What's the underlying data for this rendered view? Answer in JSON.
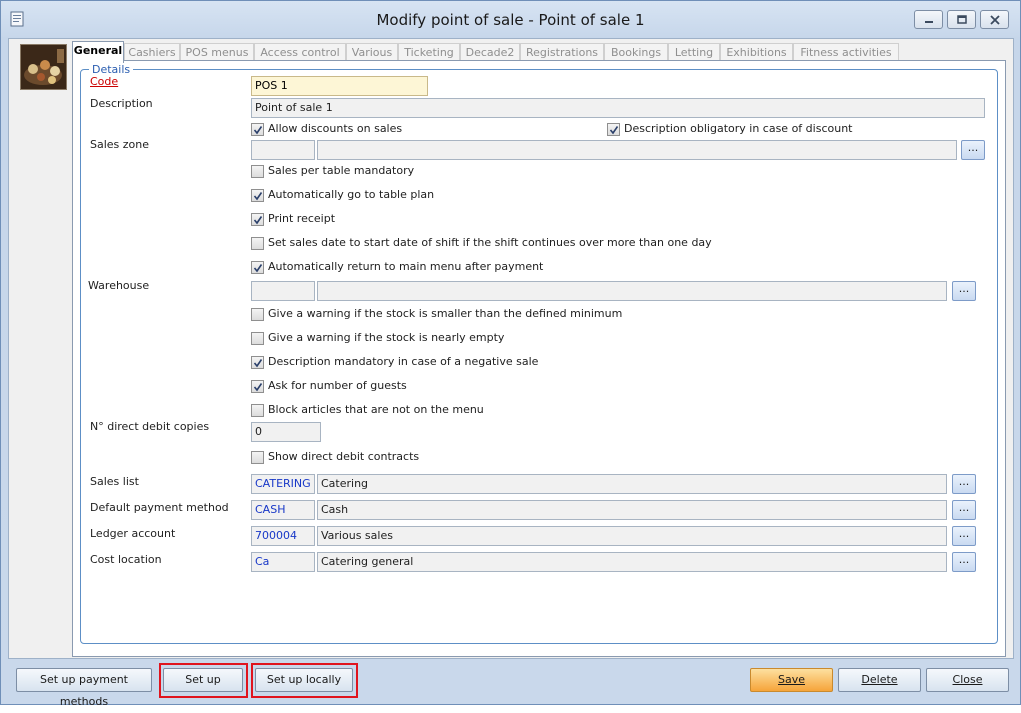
{
  "window": {
    "title": "Modify point of sale - Point of sale 1",
    "minimize_label": "minimize",
    "restore_label": "restore",
    "close_label": "close"
  },
  "tabs": [
    {
      "label": "General",
      "active": true
    },
    {
      "label": "Cashiers"
    },
    {
      "label": "POS menus"
    },
    {
      "label": "Access control"
    },
    {
      "label": "Various"
    },
    {
      "label": "Ticketing"
    },
    {
      "label": "Decade2"
    },
    {
      "label": "Registrations"
    },
    {
      "label": "Bookings"
    },
    {
      "label": "Letting"
    },
    {
      "label": "Exhibitions"
    },
    {
      "label": "Fitness activities"
    }
  ],
  "details": {
    "legend": "Details",
    "code_label": "Code",
    "code_value": "POS 1",
    "description_label": "Description",
    "description_value": "Point of sale 1",
    "sales_zone_label": "Sales zone",
    "sales_zone_code": "",
    "sales_zone_desc": "",
    "warehouse_label": "Warehouse",
    "warehouse_code": "",
    "warehouse_desc": "",
    "direct_debit_label": "N° direct debit copies",
    "direct_debit_value": "0",
    "sales_list_label": "Sales list",
    "sales_list_code": "CATERING",
    "sales_list_desc": "Catering",
    "payment_label": "Default payment method",
    "payment_code": "CASH",
    "payment_desc": "Cash",
    "ledger_label": "Ledger account",
    "ledger_code": "700004",
    "ledger_desc": "Various sales",
    "cost_label": "Cost location",
    "cost_code": "Ca",
    "cost_desc": "Catering general",
    "browse_label": "..."
  },
  "checkboxes": {
    "allow_discounts": {
      "label": "Allow discounts on sales",
      "checked": true
    },
    "desc_obligatory_discount": {
      "label": "Description obligatory in case of discount",
      "checked": true
    },
    "sales_per_table": {
      "label": "Sales per table mandatory",
      "checked": false
    },
    "auto_table_plan": {
      "label": "Automatically go to table plan",
      "checked": true
    },
    "print_receipt": {
      "label": "Print receipt",
      "checked": true
    },
    "set_sales_date": {
      "label": "Set sales date to start date of shift if the shift continues over more than one day",
      "checked": false
    },
    "auto_return_menu": {
      "label": "Automatically return to main menu after payment",
      "checked": true
    },
    "warn_stock_min": {
      "label": "Give a warning if the stock is smaller than the defined minimum",
      "checked": false
    },
    "warn_stock_empty": {
      "label": "Give a warning if the stock is nearly empty",
      "checked": false
    },
    "desc_negative_sale": {
      "label": "Description mandatory in case of a negative sale",
      "checked": true
    },
    "ask_guests": {
      "label": "Ask for number of guests",
      "checked": true
    },
    "block_articles": {
      "label": "Block articles that are not on the menu",
      "checked": false
    },
    "show_direct_debit": {
      "label": "Show direct debit contracts",
      "checked": false
    }
  },
  "buttons": {
    "setup_payment": "Set up payment methods",
    "setup": "Set up",
    "setup_locally": "Set up locally",
    "save": "Save",
    "delete": "Delete",
    "close": "Close"
  },
  "colors": {
    "highlight": "#e0141e",
    "required_label": "#cc0000",
    "lookup_code": "#1838c8",
    "save_button": "#f6a43a"
  }
}
